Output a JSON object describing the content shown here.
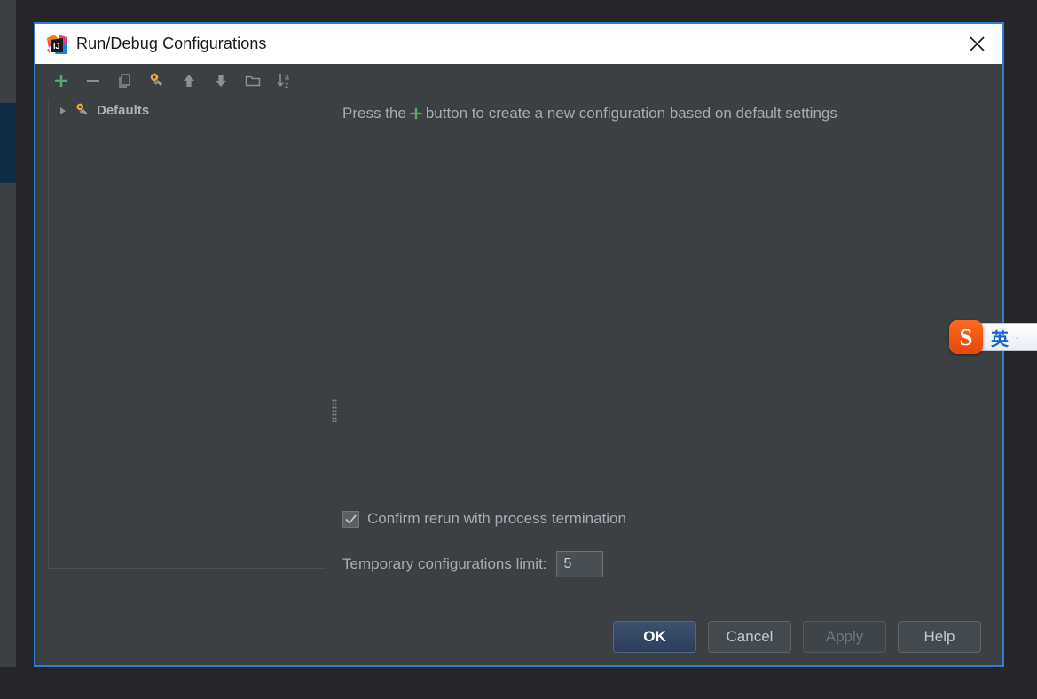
{
  "window": {
    "title": "Run/Debug Configurations",
    "app_icon": "intellij-idea-logo",
    "close_icon": "close-icon",
    "border_color": "#2d7cd6",
    "titlebar_bg": "#ffffff",
    "content_bg": "#3c4043"
  },
  "toolbar": {
    "items": [
      {
        "icon": "add-icon",
        "label": "Add New Configuration",
        "color": "#59a869"
      },
      {
        "icon": "remove-icon",
        "label": "Remove Configuration",
        "color": "#8b9095"
      },
      {
        "icon": "copy-icon",
        "label": "Copy Configuration",
        "color": "#8b9095"
      },
      {
        "icon": "edit-defaults-icon",
        "label": "Edit Defaults",
        "color": "#f0a732"
      },
      {
        "icon": "move-up-icon",
        "label": "Move Up",
        "color": "#8b9095"
      },
      {
        "icon": "move-down-icon",
        "label": "Move Down",
        "color": "#8b9095"
      },
      {
        "icon": "folder-icon",
        "label": "Create New Folder",
        "color": "#8b9095"
      },
      {
        "icon": "sort-alphabetically-icon",
        "label": "Sort Configurations",
        "color": "#8b9095"
      }
    ]
  },
  "tree": {
    "nodes": [
      {
        "label": "Defaults",
        "icon": "wrench-gear-icon",
        "expanded": false,
        "expander_icon": "triangle-right-icon"
      }
    ]
  },
  "hint": {
    "text_before": "Press the",
    "inline_icon": "add-icon",
    "text_after": "button to create a new configuration based on default settings"
  },
  "options": {
    "confirm_rerun": {
      "label": "Confirm rerun with process termination",
      "checked": true,
      "check_icon": "checkmark-icon"
    },
    "temporary_limit": {
      "label": "Temporary configurations limit:",
      "value": "5",
      "placeholder": "5"
    }
  },
  "footer": {
    "buttons": [
      {
        "label": "OK",
        "state": "default",
        "name": "ok-button"
      },
      {
        "label": "Cancel",
        "state": "normal",
        "name": "cancel-button"
      },
      {
        "label": "Apply",
        "state": "disabled",
        "name": "apply-button"
      },
      {
        "label": "Help",
        "state": "normal",
        "name": "help-button"
      }
    ]
  },
  "ime": {
    "logo_text": "S",
    "language": "英",
    "dot": "·",
    "logo_color": "#fa6a1e",
    "lang_color": "#1565c8"
  }
}
